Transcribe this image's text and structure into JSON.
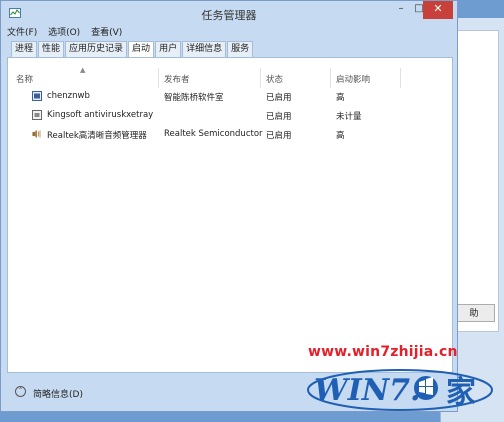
{
  "window": {
    "title": "任务管理器",
    "min_glyph": "–",
    "max_glyph": "□",
    "close_glyph": "✕"
  },
  "menu": [
    "文件(F)",
    "选项(O)",
    "查看(V)"
  ],
  "tabs": [
    {
      "label": "进程",
      "active": false
    },
    {
      "label": "性能",
      "active": false
    },
    {
      "label": "应用历史记录",
      "active": false
    },
    {
      "label": "启动",
      "active": true
    },
    {
      "label": "用户",
      "active": false
    },
    {
      "label": "详细信息",
      "active": false
    },
    {
      "label": "服务",
      "active": false
    }
  ],
  "table": {
    "columns": [
      "名称",
      "发布者",
      "状态",
      "启动影响"
    ],
    "rows": [
      {
        "name": "chenznwb",
        "publisher": "智能陈桥软件室",
        "status": "已启用",
        "impact": "高",
        "icon": "app-icon"
      },
      {
        "name": "Kingsoft antiviruskxetray",
        "publisher": "",
        "status": "已启用",
        "impact": "未计量",
        "icon": "app-icon"
      },
      {
        "name": "Realtek高清晰音频管理器",
        "publisher": "Realtek Semiconductor",
        "status": "已启用",
        "impact": "高",
        "icon": "speaker-icon"
      }
    ]
  },
  "status_bar": {
    "fewer_details": "简略信息(D)"
  },
  "background_window": {
    "button_label": "助"
  },
  "watermark": {
    "url": "www.win7zhijia.cn",
    "logo_text": "WIN7.家"
  },
  "colors": {
    "close_red": "#c7413a",
    "watermark_red": "#e4202b",
    "accent_blue": "#1f5fb4"
  }
}
